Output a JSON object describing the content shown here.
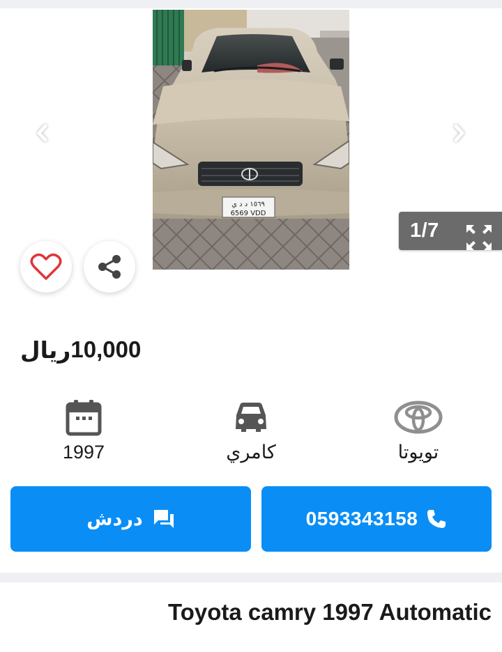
{
  "gallery": {
    "counter": "1/7",
    "prev_icon": "chevron-left-icon",
    "next_icon": "chevron-right-icon",
    "fullscreen_icon": "fullscreen-icon",
    "plate_top": "١٥٦٩ د د ي",
    "plate_bottom": "6569 VDD"
  },
  "actions": {
    "favorite_icon": "heart-icon",
    "share_icon": "share-icon",
    "heart_color": "#e0343b"
  },
  "price": {
    "value": "10,000",
    "currency": "ريال"
  },
  "specs": {
    "year": "1997",
    "model": "كامري",
    "make": "تويوتا"
  },
  "buttons": {
    "chat_label": "دردش",
    "phone_number": "0593343158",
    "accent_color": "#0a8ef6"
  },
  "listing": {
    "title": "Toyota camry 1997 Automatic"
  }
}
